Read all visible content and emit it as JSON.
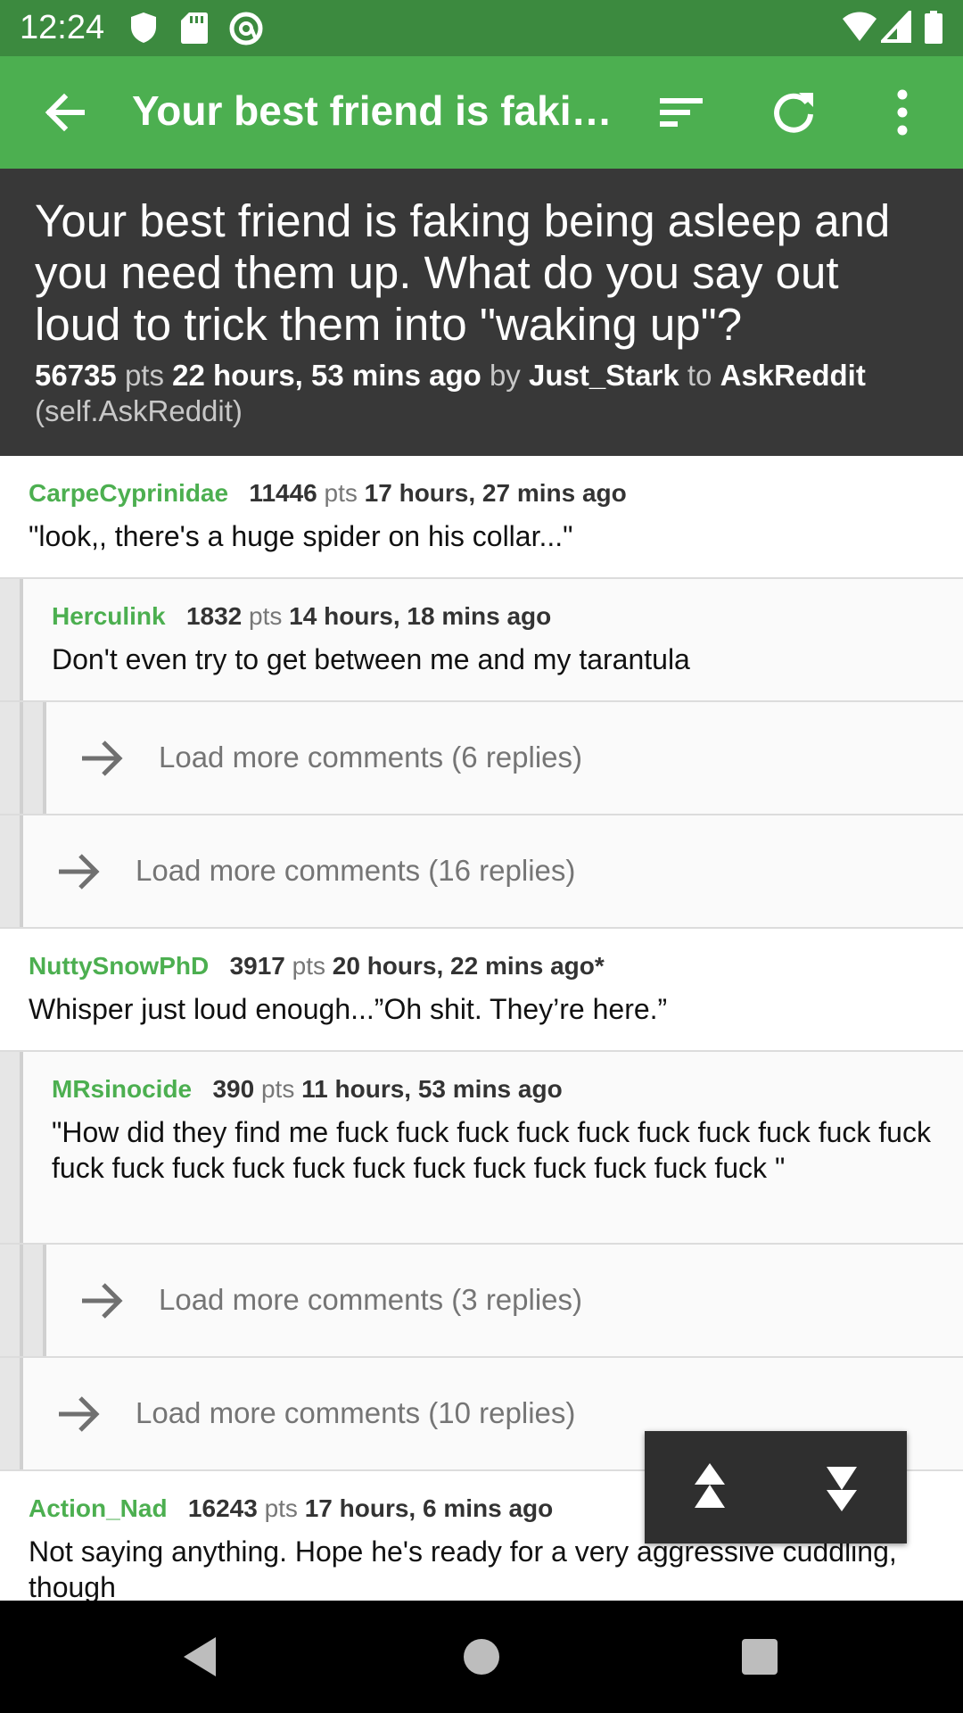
{
  "status_bar": {
    "time": "12:24"
  },
  "toolbar": {
    "title": "Your best friend is faki…"
  },
  "post": {
    "title": "Your best friend is faking being asleep and you need them up. What do you say out loud to trick them into \"waking up\"?",
    "points": "56735",
    "pts_label": "pts",
    "time": "22 hours, 53 mins ago",
    "by_label": "by",
    "author": "Just_Stark",
    "to_label": "to",
    "subreddit": "AskReddit",
    "self": "(self.AskReddit)"
  },
  "comments": [
    {
      "author": "CarpeCyprinidae",
      "points": "11446",
      "pts_label": "pts",
      "time": "17 hours, 27 mins ago",
      "body": "\"look,, there's a huge spider on his collar...\""
    },
    {
      "author": "Herculink",
      "points": "1832",
      "pts_label": "pts",
      "time": "14 hours, 18 mins ago",
      "body": "Don't even try to get between me and my tarantula"
    },
    {
      "author": "NuttySnowPhD",
      "points": "3917",
      "pts_label": "pts",
      "time": "20 hours, 22 mins ago*",
      "body": "Whisper just loud enough...”Oh shit. They’re here.”"
    },
    {
      "author": "MRsinocide",
      "points": "390",
      "pts_label": "pts",
      "time": "11 hours, 53 mins ago",
      "body": "\"How did they find me fuck fuck fuck fuck fuck fuck fuck fuck fuck fuck fuck fuck fuck fuck fuck fuck fuck fuck fuck fuck fuck fuck \""
    },
    {
      "author": "Action_Nad",
      "points": "16243",
      "pts_label": "pts",
      "time": "17 hours, 6 mins ago",
      "body": "Not saying anything.  Hope he's ready for a very aggressive cuddling, though"
    }
  ],
  "load_more": [
    {
      "label": "Load more comments (6 replies)"
    },
    {
      "label": "Load more comments (16 replies)"
    },
    {
      "label": "Load more comments (3 replies)"
    },
    {
      "label": "Load more comments (10 replies)"
    }
  ],
  "colors": {
    "accent": "#4caf50",
    "status_bar": "#3c8a3f",
    "header_bg": "#383838"
  },
  "icons": {
    "toolbar": [
      "back-arrow-icon",
      "sort-icon",
      "refresh-icon",
      "more-vert-icon"
    ],
    "scroll": [
      "scroll-up-icon",
      "scroll-down-icon"
    ],
    "nav": [
      "nav-back-icon",
      "nav-home-icon",
      "nav-recents-icon"
    ]
  }
}
